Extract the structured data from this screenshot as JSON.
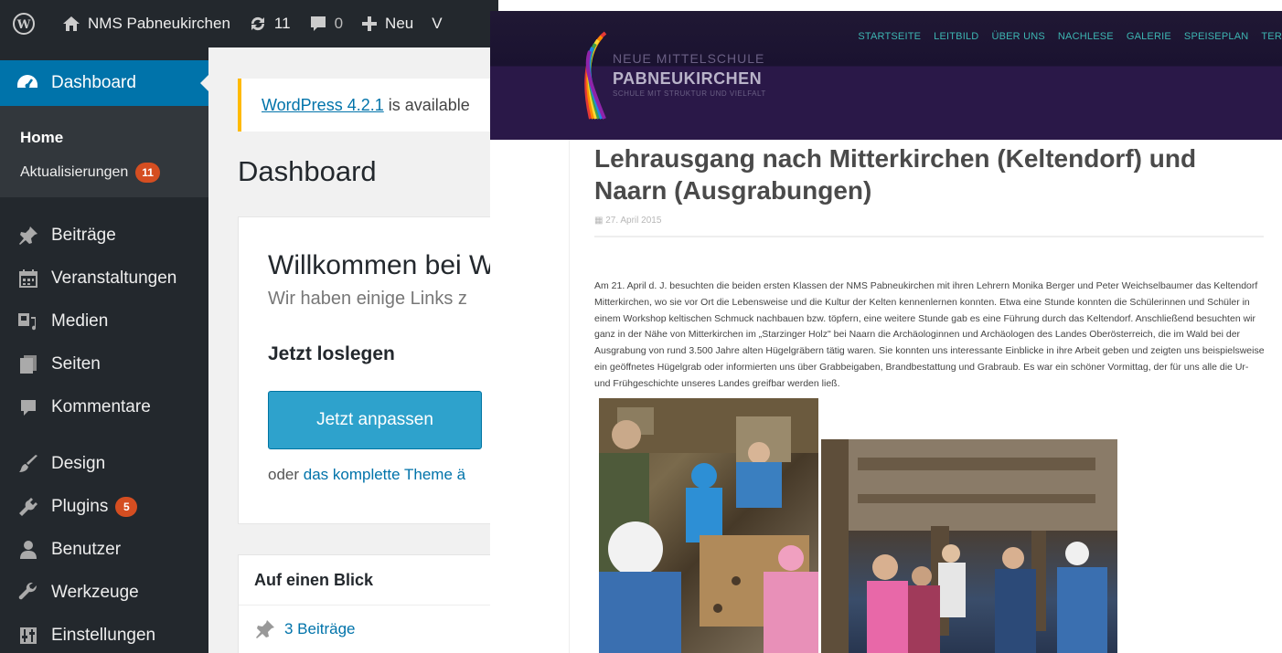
{
  "wp": {
    "adminbar": {
      "site_name": "NMS Pabneukirchen",
      "updates_count": "11",
      "comments_count": "0",
      "new_label": "Neu",
      "overflow_char": "V"
    },
    "sidebar": {
      "dashboard_label": "Dashboard",
      "submenu": {
        "home": "Home",
        "updates": "Aktualisierungen",
        "updates_badge": "11"
      },
      "items": [
        {
          "label": "Beiträge",
          "icon": "pin-icon"
        },
        {
          "label": "Veranstaltungen",
          "icon": "calendar-icon"
        },
        {
          "label": "Medien",
          "icon": "media-icon"
        },
        {
          "label": "Seiten",
          "icon": "pages-icon"
        },
        {
          "label": "Kommentare",
          "icon": "comment-icon"
        },
        {
          "label": "Design",
          "icon": "brush-icon"
        },
        {
          "label": "Plugins",
          "icon": "plugin-icon",
          "badge": "5"
        },
        {
          "label": "Benutzer",
          "icon": "user-icon"
        },
        {
          "label": "Werkzeuge",
          "icon": "wrench-icon"
        },
        {
          "label": "Einstellungen",
          "icon": "settings-icon"
        }
      ]
    },
    "notice": {
      "link": "WordPress 4.2.1",
      "text": " is available"
    },
    "page_title": "Dashboard",
    "welcome": {
      "title": "Willkommen bei W",
      "about": "Wir haben einige Links z",
      "get_started": "Jetzt loslegen",
      "button": "Jetzt anpassen",
      "or_text": "oder ",
      "or_link": "das komplette Theme ä"
    },
    "glance": {
      "title": "Auf einen Blick",
      "posts": "3 Beiträge"
    },
    "colors": {
      "adminbar": "#23282d",
      "accent": "#0073aa",
      "badge": "#d54e21",
      "notice": "#ffba00",
      "button": "#2ea2cc"
    }
  },
  "site": {
    "logo": {
      "line1": "NEUE MITTELSCHULE",
      "line2": "PABNEUKIRCHEN",
      "line3": "SCHULE MIT STRUKTUR UND VIELFALT"
    },
    "nav": [
      "STARTSEITE",
      "LEITBILD",
      "ÜBER UNS",
      "NACHLESE",
      "GALERIE",
      "SPEISEPLAN",
      "TER"
    ],
    "post": {
      "title": "Lehrausgang nach Mitterkirchen (Keltendorf) und Naarn (Ausgrabungen)",
      "date": "27. April 2015",
      "body": "Am 21. April d. J. besuchten die beiden ersten Klassen der NMS Pabneukirchen mit ihren Lehrern Monika Berger und Peter Weichselbaumer das Keltendorf Mitterkirchen, wo sie vor Ort die Lebensweise und die Kultur der Kelten kennenlernen konnten. Etwa eine Stunde konnten die Schülerinnen und Schüler in einem Workshop keltischen Schmuck nachbauen bzw. töpfern, eine weitere Stunde gab es eine Führung durch das Keltendorf. Anschließend besuchten wir ganz in der Nähe von Mitterkirchen im „Starzinger Holz\" bei Naarn die Archäologinnen und Archäologen des Landes Oberösterreich, die im Wald bei der Ausgrabung von rund 3.500 Jahre alten Hügelgräbern tätig waren. Sie konnten uns interessante Einblicke in ihre Arbeit geben und zeigten uns beispielsweise ein geöffnetes Hügelgrab oder informierten uns über Grabbeigaben, Brandbestattung und Grabraub. Es war ein schöner Vormittag, der für uns alle die Ur- und Frühgeschichte unseres Landes greifbar werden ließ."
    },
    "colors": {
      "header": "#2a1848",
      "nav": "#3db6b2"
    }
  }
}
